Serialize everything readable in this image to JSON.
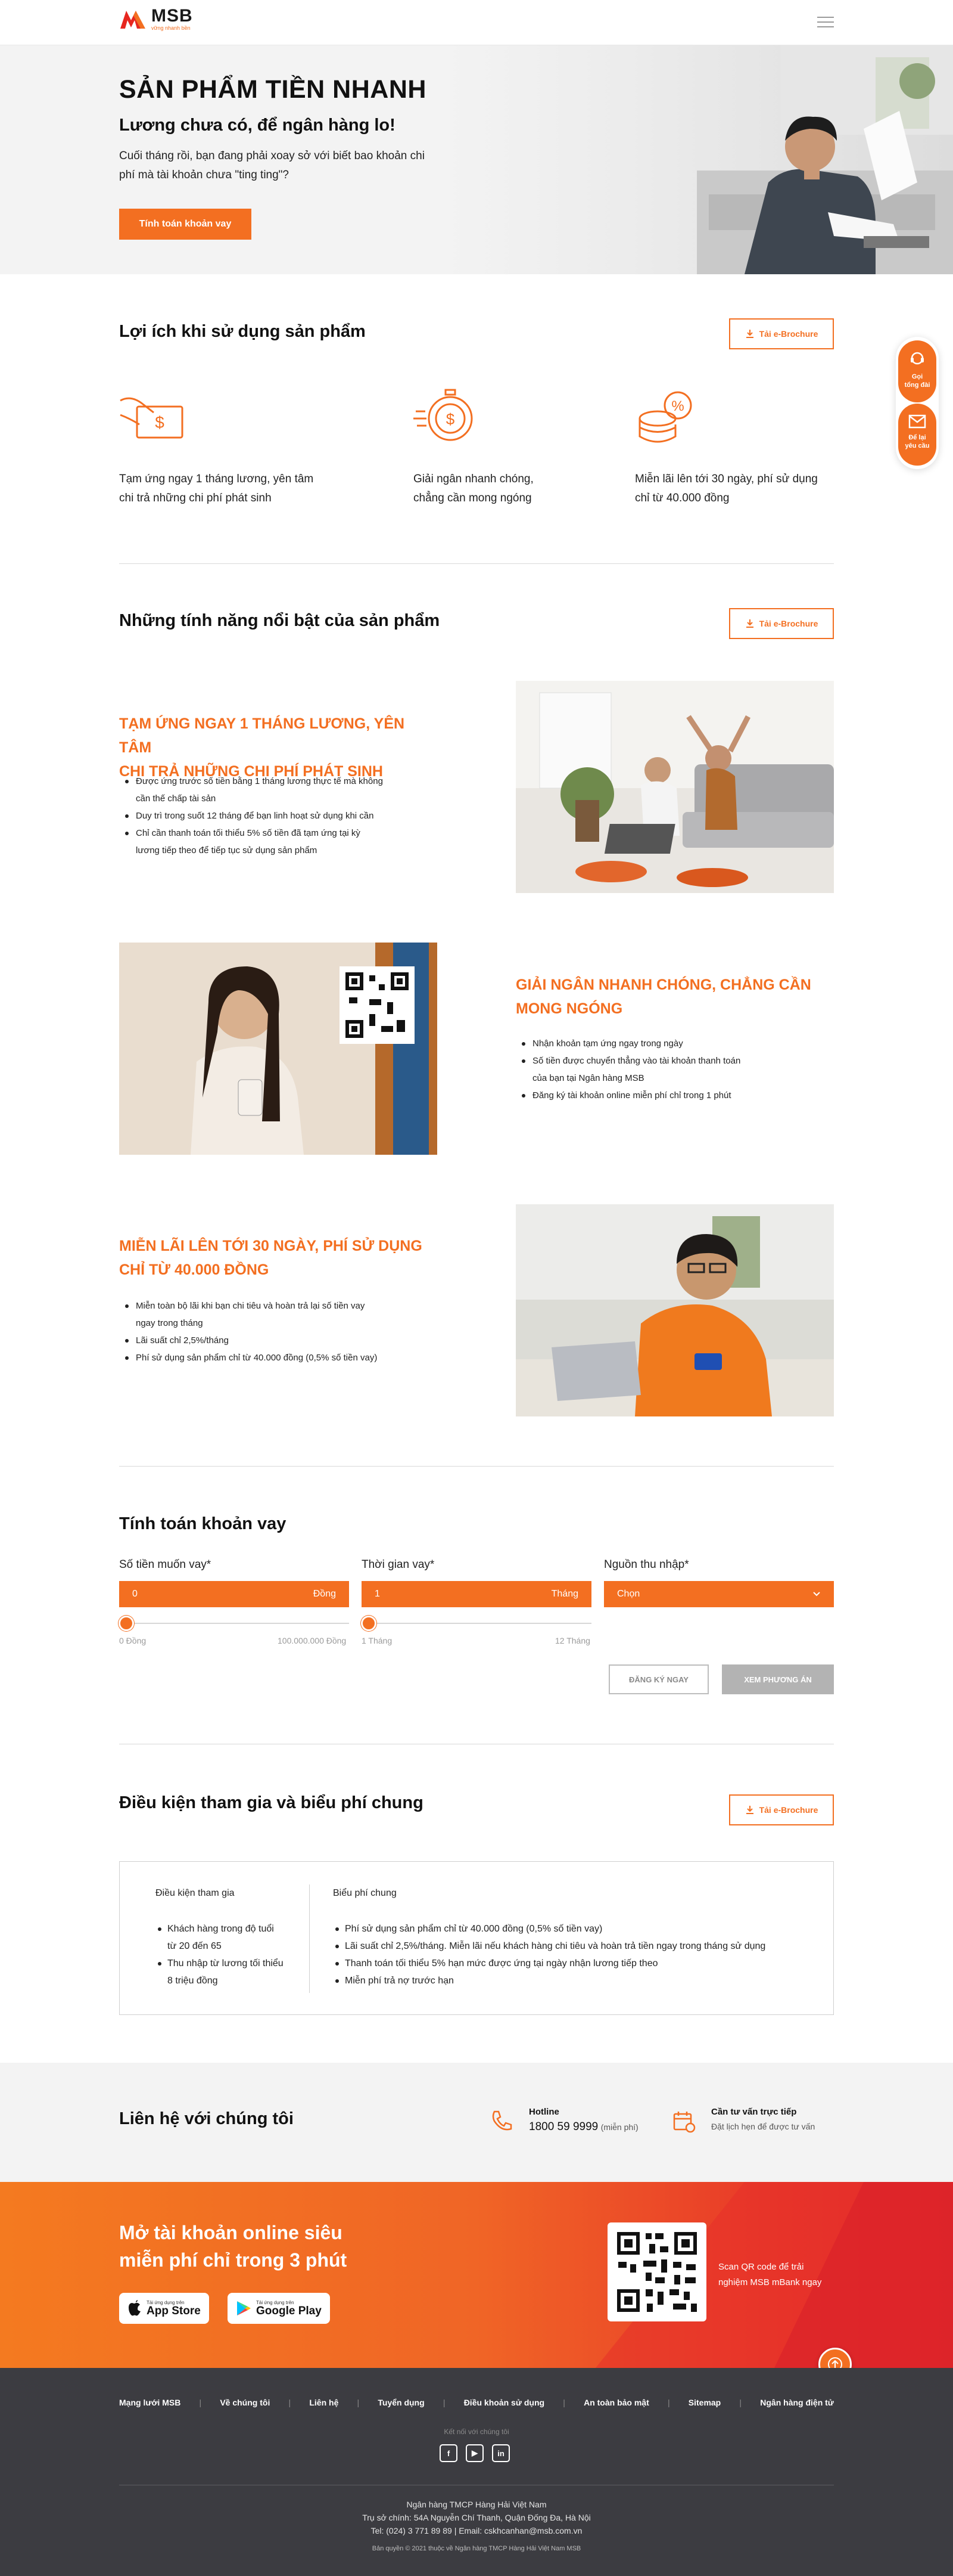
{
  "header": {
    "logo_text": "MSB",
    "logo_tagline": "vững nhanh bền",
    "menu_icon": "hamburger-icon"
  },
  "hero": {
    "title": "SẢN PHẨM TIỀN NHANH",
    "subtitle": "Lương chưa có, để ngân hàng lo!",
    "desc": "Cuối tháng rồi, bạn đang phải xoay sở với biết bao khoản chi phí mà tài khoản chưa \"ting ting\"?",
    "cta": "Tính toán khoản vay"
  },
  "float": {
    "call": "Gọi tổng đài",
    "request_1": "Để lại",
    "request_2": "yêu cầu"
  },
  "benefits": {
    "title": "Lợi ích khi sử dụng sản phẩm",
    "brochure": "Tải e-Brochure",
    "items": [
      {
        "icon": "money-hand-icon",
        "line1": "Tạm ứng ngay 1 tháng lương, yên tâm",
        "line2": "chi trả những chi phí phát sinh"
      },
      {
        "icon": "stopwatch-money-icon",
        "line1": "Giải ngân nhanh chóng,",
        "line2": "chẳng cần mong ngóng"
      },
      {
        "icon": "percent-coins-icon",
        "line1": "Miễn lãi lên tới 30 ngày, phí sử dụng",
        "line2": "chỉ từ 40.000 đồng"
      }
    ]
  },
  "features": {
    "title": "Những tính năng nổi bật của sản phẩm",
    "brochure": "Tải e-Brochure",
    "f1": {
      "title_1": "TẠM ỨNG NGAY 1 THÁNG LƯƠNG, YÊN TÂM",
      "title_2": "CHI TRẢ NHỮNG CHI PHÍ PHÁT SINH",
      "items": [
        "Được ứng trước số tiền bằng 1 tháng lương thực tế mà không",
        "cần thế chấp tài sản",
        "Duy trì trong suốt 12 tháng để bạn linh hoạt sử dụng khi cần",
        "Chỉ cần thanh toán tối thiểu 5% số tiền đã tạm ứng tại kỳ",
        "lương tiếp theo để tiếp tục sử dụng sản phẩm"
      ]
    },
    "f2": {
      "title_1": "GIẢI NGÂN NHANH CHÓNG, CHẲNG CẦN",
      "title_2": "MONG NGÓNG",
      "items": [
        "Nhận khoản tạm ứng ngay trong ngày",
        "Số tiền được chuyển thẳng vào tài khoản thanh toán",
        "của bạn tại Ngân hàng MSB",
        "Đăng ký tài khoản online miễn phí chỉ trong 1 phút"
      ]
    },
    "f3": {
      "title_1": "MIỄN LÃI LÊN TỚI 30 NGÀY, PHÍ SỬ DỤNG",
      "title_2": "CHỈ TỪ 40.000 ĐỒNG",
      "items": [
        "Miễn toàn bộ lãi khi bạn chi tiêu và hoàn trả lại số tiền vay",
        "ngay trong tháng",
        "Lãi suất chỉ 2,5%/tháng",
        "Phí sử dụng sản phẩm chỉ từ 40.000 đồng (0,5% số tiền vay)"
      ]
    }
  },
  "calc": {
    "title": "Tính toán khoản vay",
    "amount_label": "Số tiền muốn vay*",
    "amount_value": "0",
    "amount_unit": "Đồng",
    "amount_min": "0 Đồng",
    "amount_max": "100.000.000 Đồng",
    "term_label": "Thời gian vay*",
    "term_value": "1",
    "term_unit": "Tháng",
    "term_min": "1 Tháng",
    "term_max": "12 Tháng",
    "income_label": "Nguồn thu nhập*",
    "income_value": "Chọn",
    "register": "ĐĂNG KÝ NGAY",
    "view": "XEM PHƯƠNG ÁN"
  },
  "conditions": {
    "title": "Điều kiện tham gia và biểu phí chung",
    "brochure": "Tải e-Brochure",
    "left_title": "Điều kiện tham gia",
    "left_items": [
      "Khách hàng trong độ tuổi",
      "từ 20 đến 65",
      "Thu nhập từ lương tối thiểu",
      "8 triệu đồng"
    ],
    "right_title": "Biểu phí chung",
    "right_items": [
      "Phí sử dụng sản phẩm chỉ từ 40.000 đồng (0,5% số tiền vay)",
      "Lãi suất chỉ 2,5%/tháng. Miễn lãi nếu khách hàng chi tiêu và hoàn trả tiền ngay trong tháng sử dụng",
      "Thanh toán tối thiểu 5% hạn mức được ứng tại ngày nhận lương tiếp theo",
      "Miễn phí trả nợ trước hạn"
    ]
  },
  "contact": {
    "title": "Liên hệ với chúng tôi",
    "hotline_label": "Hotline",
    "hotline": "1800 59 9999",
    "hotline_note": "(miễn phí)",
    "advice_label": "Cần tư vấn trực tiếp",
    "advice_note": "Đặt lịch hẹn để được tư vấn"
  },
  "app": {
    "title": "Mở tài khoản online siêu miễn phí chỉ trong 3 phút",
    "appstore_small": "Tải ứng dụng trên",
    "appstore": "App Store",
    "gplay_small": "Tải ứng dụng trên",
    "gplay": "Google Play",
    "qr_text": "Scan QR code để trải nghiệm MSB mBank ngay"
  },
  "footer": {
    "nav": [
      "Mạng lưới MSB",
      "Về chúng tôi",
      "Liên hệ",
      "Tuyển dụng",
      "Điều khoản sử dụng",
      "An toàn bảo mật",
      "Sitemap",
      "Ngân hàng điện tử"
    ],
    "social_title": "Kết nối với chúng tôi",
    "bank": "Ngân hàng TMCP Hàng Hải Việt Nam",
    "address": "Trụ sở chính: 54A Nguyễn Chí Thanh, Quận Đống Đa, Hà Nội",
    "contact": "Tel: (024) 3 771 89 89  |  Email: cskhcanhan@msb.com.vn",
    "copyright": "Bản quyền © 2021 thuộc về Ngân hàng TMCP Hàng Hải Việt Nam MSB"
  },
  "colors": {
    "accent": "#f36f21",
    "footer_bg": "#3c3c41",
    "hero_bg": "#f3f3f3"
  }
}
